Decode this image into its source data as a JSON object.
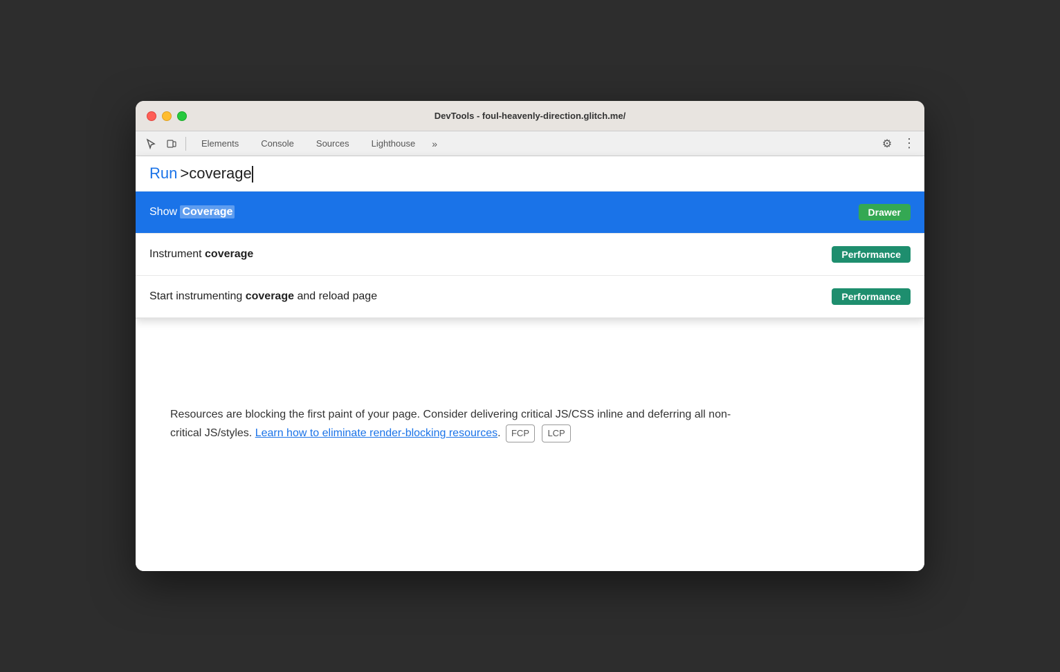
{
  "window": {
    "title": "DevTools - foul-heavenly-direction.glitch.me/"
  },
  "traffic_lights": {
    "close_label": "close",
    "minimize_label": "minimize",
    "maximize_label": "maximize"
  },
  "toolbar": {
    "tabs": [
      {
        "label": "Elements",
        "active": false
      },
      {
        "label": "Console",
        "active": false
      },
      {
        "label": "Sources",
        "active": false
      },
      {
        "label": "Lighthouse",
        "active": false
      }
    ],
    "more_label": "»",
    "settings_icon": "⚙",
    "more_icon": "⋮"
  },
  "command_palette": {
    "run_label": "Run",
    "input_value": ">coverage",
    "results": [
      {
        "id": "show-coverage",
        "prefix": "Show ",
        "highlight": "Coverage",
        "tag": "Drawer",
        "tag_color": "#34a853",
        "highlighted": true
      },
      {
        "id": "instrument-coverage",
        "prefix": "Instrument ",
        "highlight": "coverage",
        "tag": "Performance",
        "tag_color": "#1e8e6e",
        "highlighted": false
      },
      {
        "id": "start-instrument",
        "prefix": "Start instrumenting ",
        "highlight": "coverage",
        "suffix": " and reload page",
        "tag": "Performance",
        "tag_color": "#1e8e6e",
        "highlighted": false
      }
    ]
  },
  "body": {
    "description_part1": "Resources are blocking the first paint of your page. Consider delivering critical JS/CSS inline and deferring all non-critical JS/styles. ",
    "link_text": "Learn how to eliminate render-blocking resources",
    "description_part2": ". ",
    "badge1": "FCP",
    "badge2": "LCP"
  }
}
